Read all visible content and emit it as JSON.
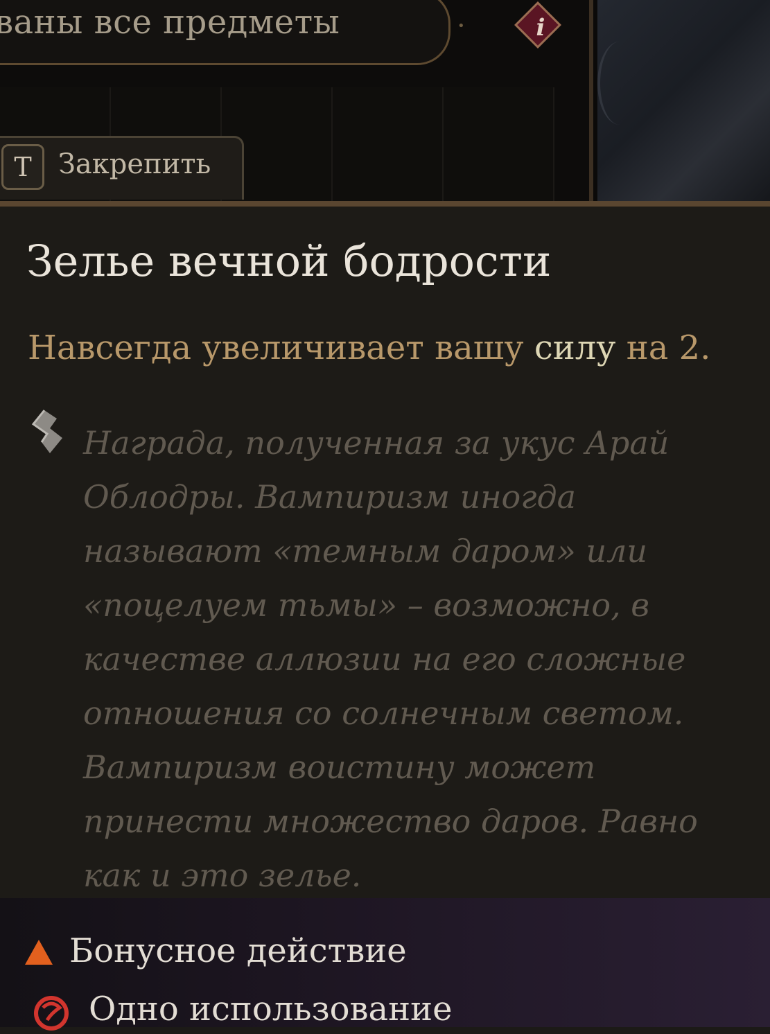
{
  "filter": {
    "text": "ваны все предметы"
  },
  "info_button": {
    "glyph": "i",
    "icon": "info-icon",
    "color": "#5a1523"
  },
  "pin_button": {
    "key": "T",
    "label": "Закрепить"
  },
  "item": {
    "title": "Зелье вечной бодрости",
    "effect_prefix": "Навсегда увеличивает вашу ",
    "effect_highlight": "силу",
    "effect_suffix": " на 2.",
    "flavor_icon": "quill-icon",
    "flavor_text": "Награда, полученная за укус Арай Облодры. Вампиризм иногда называют «темным даром» или «поцелуем тьмы» – возможно, в качестве аллюзии на его сложные отношения со солнечным светом. Вампиризм воистину может принести множество даров. Равно как и это зелье."
  },
  "costs": [
    {
      "icon": "bonus-action-triangle-icon",
      "label": "Бонусное действие",
      "color": "#e2601e"
    },
    {
      "icon": "single-use-icon",
      "label": "Одно использование",
      "color": "#d2352e"
    }
  ],
  "colors": {
    "effect": "#b8986a",
    "highlight": "#ddd6b4",
    "title": "#eae4da",
    "flavor": "#615a50"
  }
}
